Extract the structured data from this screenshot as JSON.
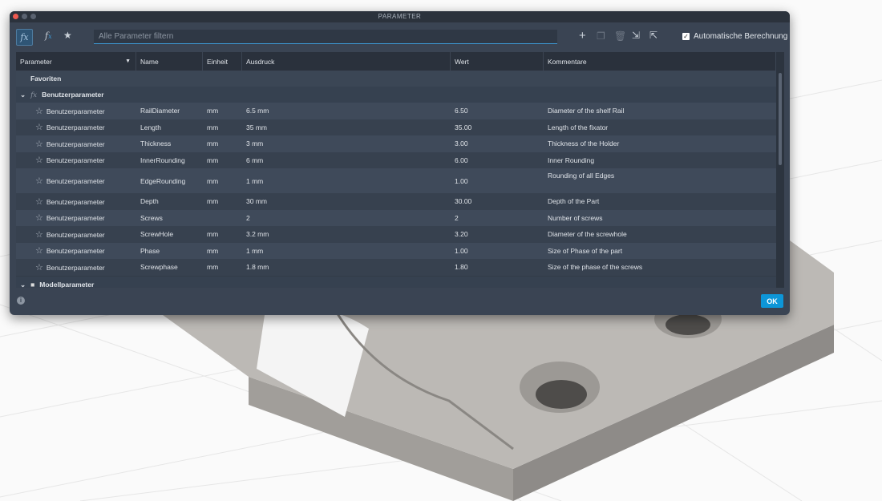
{
  "window": {
    "title": "PARAMETER"
  },
  "toolbar": {
    "filter_placeholder": "Alle Parameter filtern",
    "auto_calc_label": "Automatische Berechnung",
    "auto_calc_checked": true,
    "icons": [
      "fx-icon",
      "user-fx-icon",
      "star-icon",
      "add-icon",
      "copy-icon",
      "delete-icon",
      "import-icon",
      "export-icon"
    ]
  },
  "table": {
    "headers": [
      "Parameter",
      "Name",
      "Einheit",
      "Ausdruck",
      "Wert",
      "Kommentare"
    ],
    "favorites_label": "Favoriten",
    "group_user": "Benutzerparameter",
    "group_model": "Modellparameter",
    "rows": [
      {
        "type": "Benutzerparameter",
        "name": "RailDiameter",
        "unit": "mm",
        "expr": "6.5 mm",
        "value": "6.50",
        "comment": "Diameter of the shelf Rail"
      },
      {
        "type": "Benutzerparameter",
        "name": "Length",
        "unit": "mm",
        "expr": "35 mm",
        "value": "35.00",
        "comment": "Length of the fixator"
      },
      {
        "type": "Benutzerparameter",
        "name": "Thickness",
        "unit": "mm",
        "expr": "3 mm",
        "value": "3.00",
        "comment": "Thickness of the Holder"
      },
      {
        "type": "Benutzerparameter",
        "name": "InnerRounding",
        "unit": "mm",
        "expr": "6 mm",
        "value": "6.00",
        "comment": "Inner Rounding"
      },
      {
        "type": "Benutzerparameter",
        "name": "EdgeRounding",
        "unit": "mm",
        "expr": "1 mm",
        "value": "1.00",
        "comment": "Rounding of all Edges"
      },
      {
        "type": "Benutzerparameter",
        "name": "Depth",
        "unit": "mm",
        "expr": "30 mm",
        "value": "30.00",
        "comment": "Depth of the Part"
      },
      {
        "type": "Benutzerparameter",
        "name": "Screws",
        "unit": "",
        "expr": "2",
        "value": "2",
        "comment": "Number of screws"
      },
      {
        "type": "Benutzerparameter",
        "name": "ScrewHole",
        "unit": "mm",
        "expr": "3.2 mm",
        "value": "3.20",
        "comment": "Diameter of the screwhole"
      },
      {
        "type": "Benutzerparameter",
        "name": "Phase",
        "unit": "mm",
        "expr": "1 mm",
        "value": "1.00",
        "comment": "Size of Phase of the part"
      },
      {
        "type": "Benutzerparameter",
        "name": "Screwphase",
        "unit": "mm",
        "expr": "1.8 mm",
        "value": "1.80",
        "comment": "Size of the phase of the screws"
      }
    ]
  },
  "footer": {
    "ok_label": "OK"
  }
}
